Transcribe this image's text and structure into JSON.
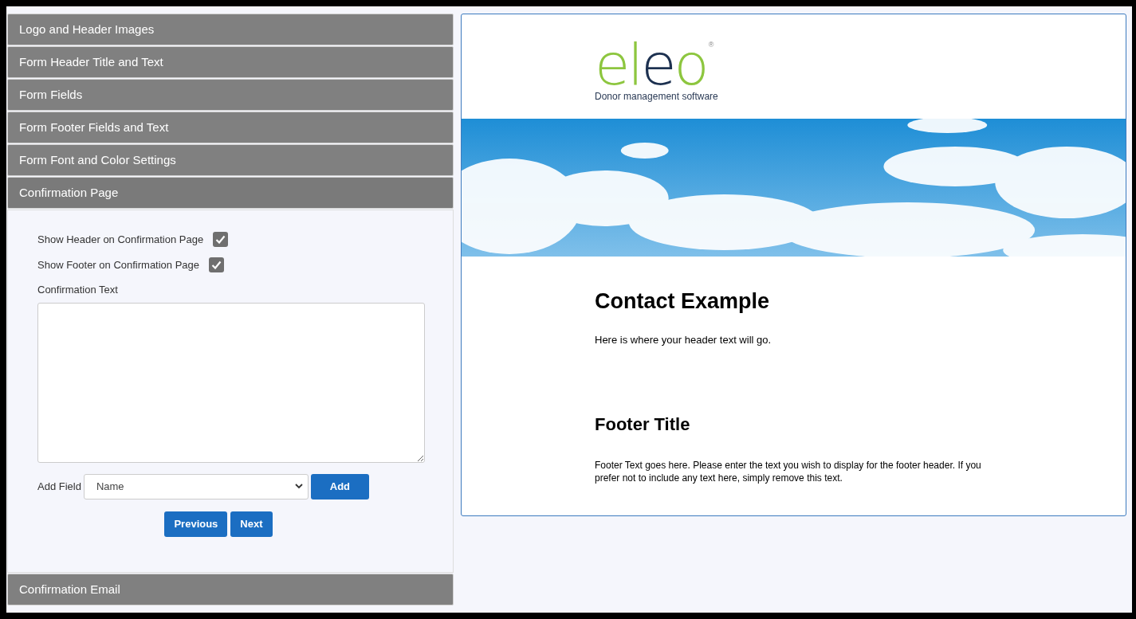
{
  "sections": [
    {
      "title": "Logo and Header Images",
      "expanded": false
    },
    {
      "title": "Form Header Title and Text",
      "expanded": false
    },
    {
      "title": "Form Fields",
      "expanded": false
    },
    {
      "title": "Form Footer Fields and Text",
      "expanded": false
    },
    {
      "title": "Form Font and Color Settings",
      "expanded": false
    },
    {
      "title": "Confirmation Page",
      "expanded": true
    },
    {
      "title": "Confirmation Email",
      "expanded": false
    }
  ],
  "confirmation": {
    "options": [
      {
        "label": "Show Header on Confirmation Page",
        "checked": true
      },
      {
        "label": "Show Footer on Confirmation Page",
        "checked": true
      }
    ],
    "text_label": "Confirmation Text",
    "add_field_label": "Add Field",
    "add_field_value": "Name",
    "add_button": "Add",
    "nav_buttons": [
      "Previous",
      "Next"
    ]
  },
  "preview": {
    "logo": {
      "letters": [
        {
          "char": "e",
          "color": "#8dc63f"
        },
        {
          "char": "l",
          "color": "#8dc63f"
        },
        {
          "char": "e",
          "color": "#1d3150"
        },
        {
          "char": "o",
          "color": "#8dc63f"
        }
      ],
      "mark": "®",
      "tagline": "Donor management software"
    },
    "title": "Contact Example",
    "header_text": "Here is where your header text will go.",
    "footer_title": "Footer Title",
    "footer_text": "Footer Text goes here. Please enter the text you wish to display for the footer header. If you prefer not to include any text here, simply remove this text."
  }
}
